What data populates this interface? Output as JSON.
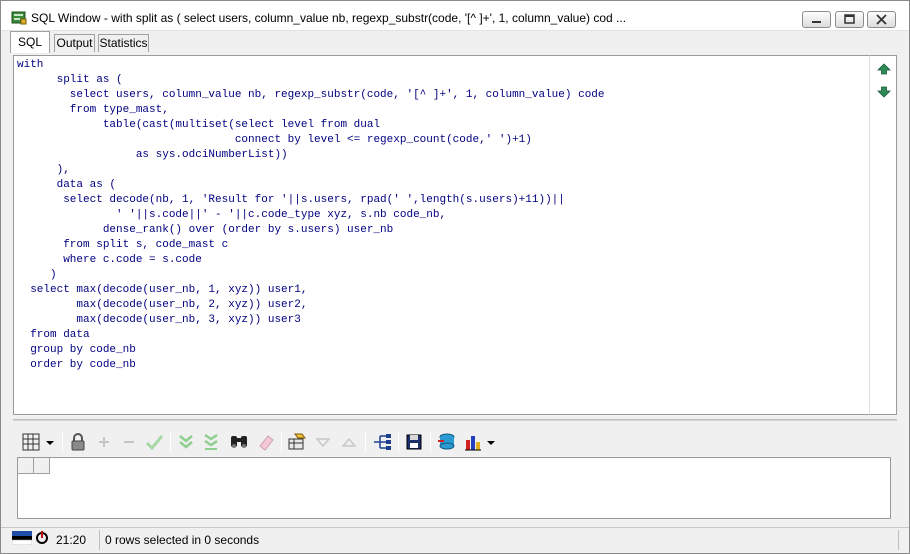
{
  "window": {
    "title": "SQL Window - with split as ( select users, column_value nb, regexp_substr(code, '[^ ]+', 1, column_value) cod ..."
  },
  "tabs": [
    {
      "label": "SQL",
      "active": true
    },
    {
      "label": "Output",
      "active": false
    },
    {
      "label": "Statistics",
      "active": false
    }
  ],
  "editor": {
    "lines": [
      "with",
      "      split as (",
      "        select users, column_value nb, regexp_substr(code, '[^ ]+', 1, column_value) code",
      "        from type_mast,",
      "             table(cast(multiset(select level from dual",
      "                                 connect by level <= regexp_count(code,' ')+1)",
      "                  as sys.odciNumberList))",
      "      ),",
      "      data as (",
      "       select decode(nb, 1, 'Result for '||s.users, rpad(' ',length(s.users)+11))||",
      "               ' '||s.code||' - '||c.code_type xyz, s.nb code_nb,",
      "             dense_rank() over (order by s.users) user_nb",
      "       from split s, code_mast c",
      "       where c.code = s.code",
      "     )",
      "  select max(decode(user_nb, 1, xyz)) user1,",
      "         max(decode(user_nb, 2, xyz)) user2,",
      "         max(decode(user_nb, 3, xyz)) user3",
      "  from data",
      "  group by code_nb",
      "  order by code_nb"
    ]
  },
  "toolbar": {
    "buttons": [
      "grid-options-icon",
      "lock-icon",
      "insert-record-icon",
      "delete-record-icon",
      "post-record-icon",
      "fetch-next-icon",
      "fetch-last-icon",
      "find-icon",
      "clear-icon",
      "query-by-example-icon",
      "previous-record-icon",
      "next-record-icon",
      "single-record-view-icon",
      "export-icon",
      "database-icon",
      "chart-icon"
    ]
  },
  "status": {
    "time": "21:20",
    "message": "0 rows selected in 0 seconds"
  },
  "colors": {
    "code_text": "#000080",
    "accent_green": "#2e8b57",
    "window_bg": "#f0f0f0"
  }
}
